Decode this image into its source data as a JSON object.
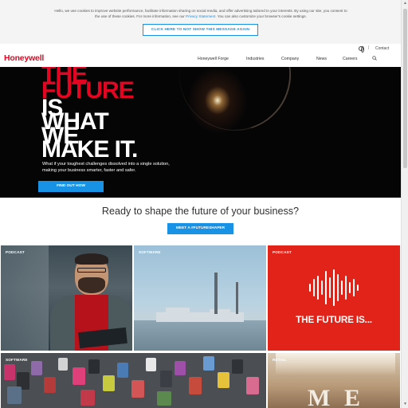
{
  "cookie": {
    "text_line1": "Hello, we use cookies to improve website performance, facilitate information sharing on social media, and offer advertising tailored to your interests. By using our site, you consent to",
    "text_line2_before": "the use of these cookies. For more information, see our ",
    "privacy_link": "Privacy Statement",
    "text_line2_after": ". You can also customize your browser's cookie settings.",
    "button": "CLICK HERE TO NOT SHOW THIS MESSAGE AGAIN"
  },
  "utility": {
    "separator": "|",
    "contact": "Contact",
    "globe_icon": "globe-icon"
  },
  "nav": {
    "logo": "Honeywell",
    "items": [
      "Honeywell Forge",
      "Industries",
      "Company",
      "News",
      "Careers"
    ],
    "search_icon": "search-icon"
  },
  "hero": {
    "lines": [
      "THE",
      "FUTURE",
      "IS",
      "WHAT",
      "WE",
      "MAKE IT."
    ],
    "subtitle": "What if your toughest challenges dissolved into a single solution, making your business smarter, faster and safer.",
    "button": "FIND OUT HOW"
  },
  "section": {
    "title": "Ready to shape the future of your business?",
    "button": "MEET A #FUTURESHAPER"
  },
  "cards": [
    {
      "label": "PODCAST"
    },
    {
      "label": "SOFTWARE"
    },
    {
      "label": "PODCAST",
      "title": "THE FUTURE IS..."
    },
    {
      "label": "SOFTWARE"
    },
    {
      "label": "RETAIL"
    }
  ],
  "colors": {
    "brand_red": "#e40522",
    "accent_blue": "#1792e5",
    "podcast_red": "#e2231a"
  }
}
